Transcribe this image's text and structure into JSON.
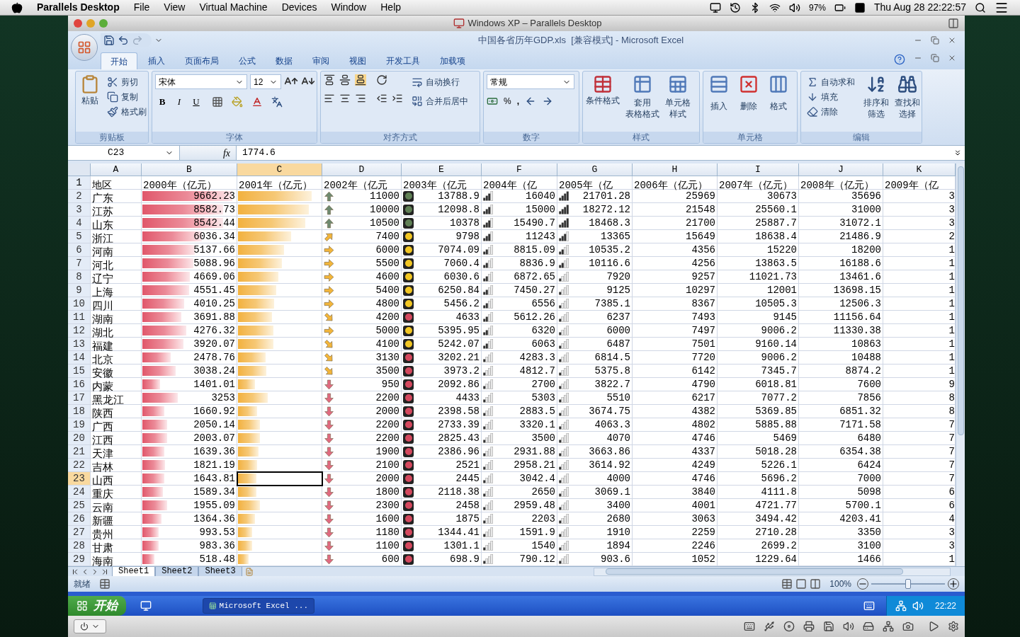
{
  "mac_menubar": {
    "app": "Parallels Desktop",
    "menus": [
      "File",
      "View",
      "Virtual Machine",
      "Devices",
      "Window",
      "Help"
    ],
    "battery": "97%",
    "clock": "Thu Aug 28 22:22:57"
  },
  "vm_window": {
    "title": "Windows XP – Parallels Desktop"
  },
  "excel": {
    "title": "中国各省历年GDP.xls  [兼容模式] - Microsoft Excel",
    "tabs": [
      {
        "label": "开始",
        "selected": true
      },
      {
        "label": "插入",
        "selected": false
      },
      {
        "label": "页面布局",
        "selected": false
      },
      {
        "label": "公式",
        "selected": false
      },
      {
        "label": "数据",
        "selected": false
      },
      {
        "label": "审阅",
        "selected": false
      },
      {
        "label": "视图",
        "selected": false
      },
      {
        "label": "开发工具",
        "selected": false
      },
      {
        "label": "加载项",
        "selected": false
      }
    ],
    "clipboard": {
      "title": "剪贴板",
      "paste": "粘贴",
      "cut": "剪切",
      "copy": "复制",
      "painter": "格式刷"
    },
    "font": {
      "title": "字体",
      "family": "宋体",
      "size": "12",
      "bold": "B",
      "italic": "I",
      "underline": "U"
    },
    "alignment": {
      "title": "对齐方式",
      "wrap": "自动换行",
      "merge": "合并后居中"
    },
    "number": {
      "title": "数字",
      "format": "常规",
      "percent": "%",
      "comma": ","
    },
    "styles": {
      "title": "样式",
      "conditional": "条件格式",
      "table": [
        "套用",
        "表格格式"
      ],
      "cell": [
        "单元格",
        "样式"
      ]
    },
    "cells": {
      "title": "单元格",
      "insert": "插入",
      "delete": "删除",
      "format": "格式"
    },
    "editing": {
      "title": "编辑",
      "autosum": "自动求和",
      "fill": "填充",
      "clear": "清除",
      "sort": [
        "排序和",
        "筛选"
      ],
      "find": [
        "查找和",
        "选择"
      ]
    },
    "formula_bar": {
      "name_box": "C23",
      "function_label": "fx",
      "value": "1774.6"
    },
    "columns": [
      {
        "label": "A",
        "selected": false
      },
      {
        "label": "B",
        "selected": false
      },
      {
        "label": "C",
        "selected": true
      },
      {
        "label": "D",
        "selected": false
      },
      {
        "label": "E",
        "selected": false
      },
      {
        "label": "F",
        "selected": false
      },
      {
        "label": "G",
        "selected": false
      },
      {
        "label": "H",
        "selected": false
      },
      {
        "label": "I",
        "selected": false
      },
      {
        "label": "J",
        "selected": false
      },
      {
        "label": "K",
        "selected": false
      }
    ],
    "header_row": {
      "row": "1",
      "cells": [
        "地区",
        "2000年（亿元）",
        "2001年（亿元）",
        "2002年（亿元",
        "2003年（亿元",
        "2004年（亿",
        "2005年（亿",
        "2006年（亿元）",
        "2007年（亿元）",
        "2008年（亿元）",
        "2009年（亿"
      ]
    },
    "rows": [
      {
        "row": "2",
        "selected": false,
        "region": "广东",
        "y2000": {
          "value": "9662.23",
          "level": 0.95
        },
        "y2001": {
          "level": 0.87
        },
        "y2002": {
          "value": "11000",
          "kind": "up"
        },
        "y2003": {
          "value": "13788.9",
          "color": "#5f7f55"
        },
        "y2004": {
          "value": "16040",
          "level": 0.75
        },
        "y2005": {
          "value": "21701.28",
          "level": 1
        },
        "y2006": "25969",
        "y2007": "30673",
        "y2008": "35696",
        "y2009": "3"
      },
      {
        "row": "3",
        "selected": false,
        "region": "江苏",
        "y2000": {
          "value": "8582.73",
          "level": 0.85
        },
        "y2001": {
          "level": 0.84
        },
        "y2002": {
          "value": "10000",
          "kind": "up"
        },
        "y2003": {
          "value": "12098.8",
          "color": "#5f7f55"
        },
        "y2004": {
          "value": "15000",
          "level": 0.75
        },
        "y2005": {
          "value": "18272.12",
          "level": 1
        },
        "y2006": "21548",
        "y2007": "25560.1",
        "y2008": "31000",
        "y2009": "3"
      },
      {
        "row": "4",
        "selected": false,
        "region": "山东",
        "y2000": {
          "value": "8542.44",
          "level": 0.85
        },
        "y2001": {
          "level": 0.8
        },
        "y2002": {
          "value": "10500",
          "kind": "up"
        },
        "y2003": {
          "value": "10378",
          "color": "#5f7f55"
        },
        "y2004": {
          "value": "15490.7",
          "level": 0.75
        },
        "y2005": {
          "value": "18468.3",
          "level": 1
        },
        "y2006": "21700",
        "y2007": "25887.7",
        "y2008": "31072.1",
        "y2009": "3"
      },
      {
        "row": "5",
        "selected": false,
        "region": "浙江",
        "y2000": {
          "value": "6036.34",
          "level": 0.63
        },
        "y2001": {
          "level": 0.63
        },
        "y2002": {
          "value": "7400",
          "kind": "upright"
        },
        "y2003": {
          "value": "9798",
          "color": "#f2c623"
        },
        "y2004": {
          "value": "11243",
          "level": 0.75
        },
        "y2005": {
          "value": "13365",
          "level": 0.75
        },
        "y2006": "15649",
        "y2007": "18638.4",
        "y2008": "21486.9",
        "y2009": "2"
      },
      {
        "row": "6",
        "selected": false,
        "region": "河南",
        "y2000": {
          "value": "5137.66",
          "level": 0.55
        },
        "y2001": {
          "level": 0.55
        },
        "y2002": {
          "value": "6000",
          "kind": "right"
        },
        "y2003": {
          "value": "7074.09",
          "color": "#f2c623"
        },
        "y2004": {
          "value": "8815.09",
          "level": 0.5
        },
        "y2005": {
          "value": "10535.2",
          "level": 0.5
        },
        "y2006": "4356",
        "y2007": "15220",
        "y2008": "18200",
        "y2009": "1"
      },
      {
        "row": "7",
        "selected": false,
        "region": "河北",
        "y2000": {
          "value": "5088.96",
          "level": 0.54
        },
        "y2001": {
          "level": 0.52
        },
        "y2002": {
          "value": "5500",
          "kind": "right"
        },
        "y2003": {
          "value": "7060.4",
          "color": "#f2c623"
        },
        "y2004": {
          "value": "8836.9",
          "level": 0.5
        },
        "y2005": {
          "value": "10116.6",
          "level": 0.5
        },
        "y2006": "4256",
        "y2007": "13863.5",
        "y2008": "16188.6",
        "y2009": "1"
      },
      {
        "row": "8",
        "selected": false,
        "region": "辽宁",
        "y2000": {
          "value": "4669.06",
          "level": 0.5
        },
        "y2001": {
          "level": 0.48
        },
        "y2002": {
          "value": "4600",
          "kind": "right"
        },
        "y2003": {
          "value": "6030.6",
          "color": "#f2c623"
        },
        "y2004": {
          "value": "6872.65",
          "level": 0.5
        },
        "y2005": {
          "value": "7920",
          "level": 0.25
        },
        "y2006": "9257",
        "y2007": "11021.73",
        "y2008": "13461.6",
        "y2009": "1"
      },
      {
        "row": "9",
        "selected": false,
        "region": "上海",
        "y2000": {
          "value": "4551.45",
          "level": 0.49
        },
        "y2001": {
          "level": 0.45
        },
        "y2002": {
          "value": "5400",
          "kind": "right"
        },
        "y2003": {
          "value": "6250.84",
          "color": "#f2c623"
        },
        "y2004": {
          "value": "7450.27",
          "level": 0.5
        },
        "y2005": {
          "value": "9125",
          "level": 0.25
        },
        "y2006": "10297",
        "y2007": "12001",
        "y2008": "13698.15",
        "y2009": "1"
      },
      {
        "row": "10",
        "selected": false,
        "region": "四川",
        "y2000": {
          "value": "4010.25",
          "level": 0.44
        },
        "y2001": {
          "level": 0.43
        },
        "y2002": {
          "value": "4800",
          "kind": "right"
        },
        "y2003": {
          "value": "5456.2",
          "color": "#f2c623"
        },
        "y2004": {
          "value": "6556",
          "level": 0.5
        },
        "y2005": {
          "value": "7385.1",
          "level": 0.25
        },
        "y2006": "8367",
        "y2007": "10505.3",
        "y2008": "12506.3",
        "y2009": "1"
      },
      {
        "row": "11",
        "selected": false,
        "region": "湖南",
        "y2000": {
          "value": "3691.88",
          "level": 0.41
        },
        "y2001": {
          "level": 0.4
        },
        "y2002": {
          "value": "4200",
          "kind": "downright"
        },
        "y2003": {
          "value": "4633",
          "color": "#d4485e"
        },
        "y2004": {
          "value": "5612.26",
          "level": 0.5
        },
        "y2005": {
          "value": "6237",
          "level": 0.25
        },
        "y2006": "7493",
        "y2007": "9145",
        "y2008": "11156.64",
        "y2009": "1"
      },
      {
        "row": "12",
        "selected": false,
        "region": "湖北",
        "y2000": {
          "value": "4276.32",
          "level": 0.46
        },
        "y2001": {
          "level": 0.42
        },
        "y2002": {
          "value": "5000",
          "kind": "right"
        },
        "y2003": {
          "value": "5395.95",
          "color": "#f2c623"
        },
        "y2004": {
          "value": "6320",
          "level": 0.5
        },
        "y2005": {
          "value": "6000",
          "level": 0.25
        },
        "y2006": "7497",
        "y2007": "9006.2",
        "y2008": "11330.38",
        "y2009": "1"
      },
      {
        "row": "13",
        "selected": false,
        "region": "福建",
        "y2000": {
          "value": "3920.07",
          "level": 0.43
        },
        "y2001": {
          "level": 0.42
        },
        "y2002": {
          "value": "4100",
          "kind": "downright"
        },
        "y2003": {
          "value": "5242.07",
          "color": "#f2c623"
        },
        "y2004": {
          "value": "6063",
          "level": 0.5
        },
        "y2005": {
          "value": "6487",
          "level": 0.25
        },
        "y2006": "7501",
        "y2007": "9160.14",
        "y2008": "10863",
        "y2009": "1"
      },
      {
        "row": "14",
        "selected": false,
        "region": "北京",
        "y2000": {
          "value": "2478.76",
          "level": 0.3
        },
        "y2001": {
          "level": 0.33
        },
        "y2002": {
          "value": "3130",
          "kind": "downright"
        },
        "y2003": {
          "value": "3202.21",
          "color": "#d4485e"
        },
        "y2004": {
          "value": "4283.3",
          "level": 0.25
        },
        "y2005": {
          "value": "6814.5",
          "level": 0.25
        },
        "y2006": "7720",
        "y2007": "9006.2",
        "y2008": "10488",
        "y2009": "1"
      },
      {
        "row": "15",
        "selected": false,
        "region": "安徽",
        "y2000": {
          "value": "3038.24",
          "level": 0.35
        },
        "y2001": {
          "level": 0.34
        },
        "y2002": {
          "value": "3500",
          "kind": "downright"
        },
        "y2003": {
          "value": "3973.2",
          "color": "#d4485e"
        },
        "y2004": {
          "value": "4812.7",
          "level": 0.25
        },
        "y2005": {
          "value": "5375.8",
          "level": 0.25
        },
        "y2006": "6142",
        "y2007": "7345.7",
        "y2008": "8874.2",
        "y2009": "1"
      },
      {
        "row": "16",
        "selected": false,
        "region": "内蒙",
        "y2000": {
          "value": "1401.01",
          "level": 0.19
        },
        "y2001": {
          "level": 0.2
        },
        "y2002": {
          "value": "950",
          "kind": "down"
        },
        "y2003": {
          "value": "2092.86",
          "color": "#d4485e"
        },
        "y2004": {
          "value": "2700",
          "level": 0.25
        },
        "y2005": {
          "value": "3822.7",
          "level": 0.25
        },
        "y2006": "4790",
        "y2007": "6018.81",
        "y2008": "7600",
        "y2009": "9"
      },
      {
        "row": "17",
        "selected": false,
        "region": "黑龙江",
        "y2000": {
          "value": "3253",
          "level": 0.37
        },
        "y2001": {
          "level": 0.35
        },
        "y2002": {
          "value": "2200",
          "kind": "down"
        },
        "y2003": {
          "value": "4433",
          "color": "#d4485e"
        },
        "y2004": {
          "value": "5303",
          "level": 0.25
        },
        "y2005": {
          "value": "5510",
          "level": 0.25
        },
        "y2006": "6217",
        "y2007": "7077.2",
        "y2008": "7856",
        "y2009": "8"
      },
      {
        "row": "18",
        "selected": false,
        "region": "陕西",
        "y2000": {
          "value": "1660.92",
          "level": 0.23
        },
        "y2001": {
          "level": 0.23
        },
        "y2002": {
          "value": "2000",
          "kind": "down"
        },
        "y2003": {
          "value": "2398.58",
          "color": "#d4485e"
        },
        "y2004": {
          "value": "2883.5",
          "level": 0.25
        },
        "y2005": {
          "value": "3674.75",
          "level": 0.25
        },
        "y2006": "4382",
        "y2007": "5369.85",
        "y2008": "6851.32",
        "y2009": "8"
      },
      {
        "row": "19",
        "selected": false,
        "region": "广西",
        "y2000": {
          "value": "2050.14",
          "level": 0.26
        },
        "y2001": {
          "level": 0.26
        },
        "y2002": {
          "value": "2200",
          "kind": "down"
        },
        "y2003": {
          "value": "2733.39",
          "color": "#d4485e"
        },
        "y2004": {
          "value": "3320.1",
          "level": 0.25
        },
        "y2005": {
          "value": "4063.3",
          "level": 0.25
        },
        "y2006": "4802",
        "y2007": "5885.88",
        "y2008": "7171.58",
        "y2009": "7"
      },
      {
        "row": "20",
        "selected": false,
        "region": "江西",
        "y2000": {
          "value": "2003.07",
          "level": 0.26
        },
        "y2001": {
          "level": 0.26
        },
        "y2002": {
          "value": "2200",
          "kind": "down"
        },
        "y2003": {
          "value": "2825.43",
          "color": "#d4485e"
        },
        "y2004": {
          "value": "3500",
          "level": 0.25
        },
        "y2005": {
          "value": "4070",
          "level": 0.25
        },
        "y2006": "4746",
        "y2007": "5469",
        "y2008": "6480",
        "y2009": "7"
      },
      {
        "row": "21",
        "selected": false,
        "region": "天津",
        "y2000": {
          "value": "1639.36",
          "level": 0.23
        },
        "y2001": {
          "level": 0.24
        },
        "y2002": {
          "value": "1900",
          "kind": "down"
        },
        "y2003": {
          "value": "2386.96",
          "color": "#d4485e"
        },
        "y2004": {
          "value": "2931.88",
          "level": 0.25
        },
        "y2005": {
          "value": "3663.86",
          "level": 0.25
        },
        "y2006": "4337",
        "y2007": "5018.28",
        "y2008": "6354.38",
        "y2009": "7"
      },
      {
        "row": "22",
        "selected": false,
        "region": "吉林",
        "y2000": {
          "value": "1821.19",
          "level": 0.24
        },
        "y2001": {
          "level": 0.23
        },
        "y2002": {
          "value": "2100",
          "kind": "down"
        },
        "y2003": {
          "value": "2521",
          "color": "#d4485e"
        },
        "y2004": {
          "value": "2958.21",
          "level": 0.25
        },
        "y2005": {
          "value": "3614.92",
          "level": 0.25
        },
        "y2006": "4249",
        "y2007": "5226.1",
        "y2008": "6424",
        "y2009": "7"
      },
      {
        "row": "23",
        "selected": true,
        "region": "山西",
        "y2000": {
          "value": "1643.81",
          "level": 0.23
        },
        "y2001": {
          "level": 0.22
        },
        "y2002": {
          "value": "2000",
          "kind": "down"
        },
        "y2003": {
          "value": "2445",
          "color": "#d4485e"
        },
        "y2004": {
          "value": "3042.4",
          "level": 0.25
        },
        "y2005": {
          "value": "4000",
          "level": 0.25
        },
        "y2006": "4746",
        "y2007": "5696.2",
        "y2008": "7000",
        "y2009": "7"
      },
      {
        "row": "24",
        "selected": false,
        "region": "重庆",
        "y2000": {
          "value": "1589.34",
          "level": 0.22
        },
        "y2001": {
          "level": 0.22
        },
        "y2002": {
          "value": "1800",
          "kind": "down"
        },
        "y2003": {
          "value": "2118.38",
          "color": "#d4485e"
        },
        "y2004": {
          "value": "2650",
          "level": 0.25
        },
        "y2005": {
          "value": "3069.1",
          "level": 0.25
        },
        "y2006": "3840",
        "y2007": "4111.8",
        "y2008": "5098",
        "y2009": "6"
      },
      {
        "row": "25",
        "selected": false,
        "region": "云南",
        "y2000": {
          "value": "1955.09",
          "level": 0.26
        },
        "y2001": {
          "level": 0.26
        },
        "y2002": {
          "value": "2300",
          "kind": "down"
        },
        "y2003": {
          "value": "2458",
          "color": "#d4485e"
        },
        "y2004": {
          "value": "2959.48",
          "level": 0.25
        },
        "y2005": {
          "value": "3400",
          "level": 0.25
        },
        "y2006": "4001",
        "y2007": "4721.77",
        "y2008": "5700.1",
        "y2009": "6"
      },
      {
        "row": "26",
        "selected": false,
        "region": "新疆",
        "y2000": {
          "value": "1364.36",
          "level": 0.2
        },
        "y2001": {
          "level": 0.2
        },
        "y2002": {
          "value": "1600",
          "kind": "down"
        },
        "y2003": {
          "value": "1875",
          "color": "#d4485e"
        },
        "y2004": {
          "value": "2203",
          "level": 0.25
        },
        "y2005": {
          "value": "2680",
          "level": 0.25
        },
        "y2006": "3063",
        "y2007": "3494.42",
        "y2008": "4203.41",
        "y2009": "4"
      },
      {
        "row": "27",
        "selected": false,
        "region": "贵州",
        "y2000": {
          "value": "993.53",
          "level": 0.17
        },
        "y2001": {
          "level": 0.17
        },
        "y2002": {
          "value": "1180",
          "kind": "down"
        },
        "y2003": {
          "value": "1344.41",
          "color": "#d4485e"
        },
        "y2004": {
          "value": "1591.9",
          "level": 0.25
        },
        "y2005": {
          "value": "1910",
          "level": 0.25
        },
        "y2006": "2259",
        "y2007": "2710.28",
        "y2008": "3350",
        "y2009": "3"
      },
      {
        "row": "28",
        "selected": false,
        "region": "甘肃",
        "y2000": {
          "value": "983.36",
          "level": 0.17
        },
        "y2001": {
          "level": 0.17
        },
        "y2002": {
          "value": "1100",
          "kind": "down"
        },
        "y2003": {
          "value": "1301.1",
          "color": "#d4485e"
        },
        "y2004": {
          "value": "1540",
          "level": 0.25
        },
        "y2005": {
          "value": "1894",
          "level": 0.25
        },
        "y2006": "2246",
        "y2007": "2699.2",
        "y2008": "3100",
        "y2009": "3"
      },
      {
        "row": "29",
        "selected": false,
        "region": "海南",
        "y2000": {
          "value": "518.48",
          "level": 0.13
        },
        "y2001": {
          "level": 0.13
        },
        "y2002": {
          "value": "600",
          "kind": "down"
        },
        "y2003": {
          "value": "698.9",
          "color": "#d4485e"
        },
        "y2004": {
          "value": "790.12",
          "level": 0.25
        },
        "y2005": {
          "value": "903.6",
          "level": 0.25
        },
        "y2006": "1052",
        "y2007": "1229.64",
        "y2008": "1466",
        "y2009": "1"
      }
    ],
    "sheet_tabs": [
      {
        "label": "Sheet1",
        "selected": true
      },
      {
        "label": "Sheet2",
        "selected": false
      },
      {
        "label": "Sheet3",
        "selected": false
      }
    ],
    "status_bar": {
      "text": "就绪",
      "zoom": "100%",
      "zoom_slider": {
        "level": 0.5
      }
    }
  },
  "taskbar": {
    "start": "开始",
    "task": "Microsoft Excel ...",
    "clock": "22:22"
  }
}
